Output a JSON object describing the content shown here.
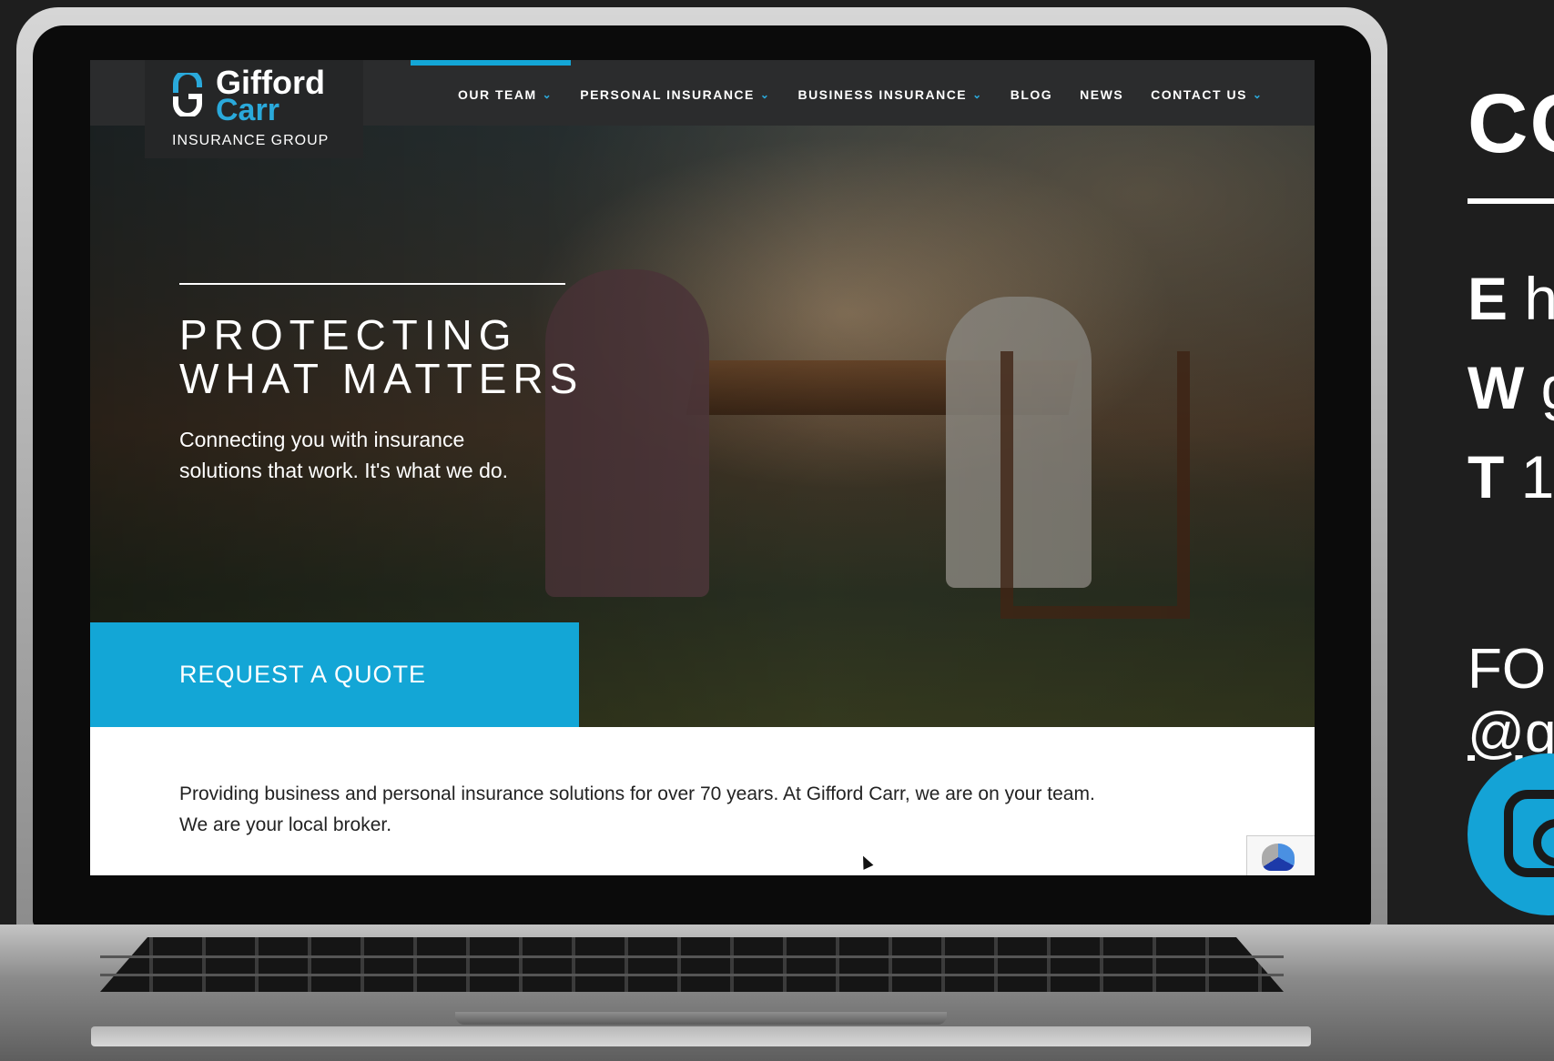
{
  "site": {
    "logo": {
      "name_line1": "Gifford",
      "name_line2": "Carr",
      "tagline": "INSURANCE GROUP"
    },
    "nav": [
      {
        "label": "OUR TEAM",
        "has_dropdown": true
      },
      {
        "label": "PERSONAL INSURANCE",
        "has_dropdown": true
      },
      {
        "label": "BUSINESS INSURANCE",
        "has_dropdown": true
      },
      {
        "label": "BLOG",
        "has_dropdown": false
      },
      {
        "label": "NEWS",
        "has_dropdown": false
      },
      {
        "label": "CONTACT US",
        "has_dropdown": true
      }
    ],
    "hero": {
      "title_line1": "PROTECTING",
      "title_line2": "WHAT MATTERS",
      "subtitle_line1": "Connecting you with insurance",
      "subtitle_line2": "solutions that work. It's what we do.",
      "cta": "REQUEST A QUOTE"
    },
    "intro_line1": "Providing business and personal insurance solutions for over 70 years. At Gifford Carr, we are on your team.",
    "intro_line2": "We are your local broker."
  },
  "side_panel": {
    "heading": "CO",
    "lines": [
      {
        "prefix": "E",
        "text": "h"
      },
      {
        "prefix": "W",
        "text": "g"
      },
      {
        "prefix": "T",
        "text": "1"
      }
    ],
    "social_label": "FO",
    "social_handle": "@g",
    "social_icon": "instagram-icon"
  },
  "colors": {
    "accent": "#13a6d6",
    "nav_bg": "#2b2c2d",
    "side_bg": "#1e1e1e"
  }
}
